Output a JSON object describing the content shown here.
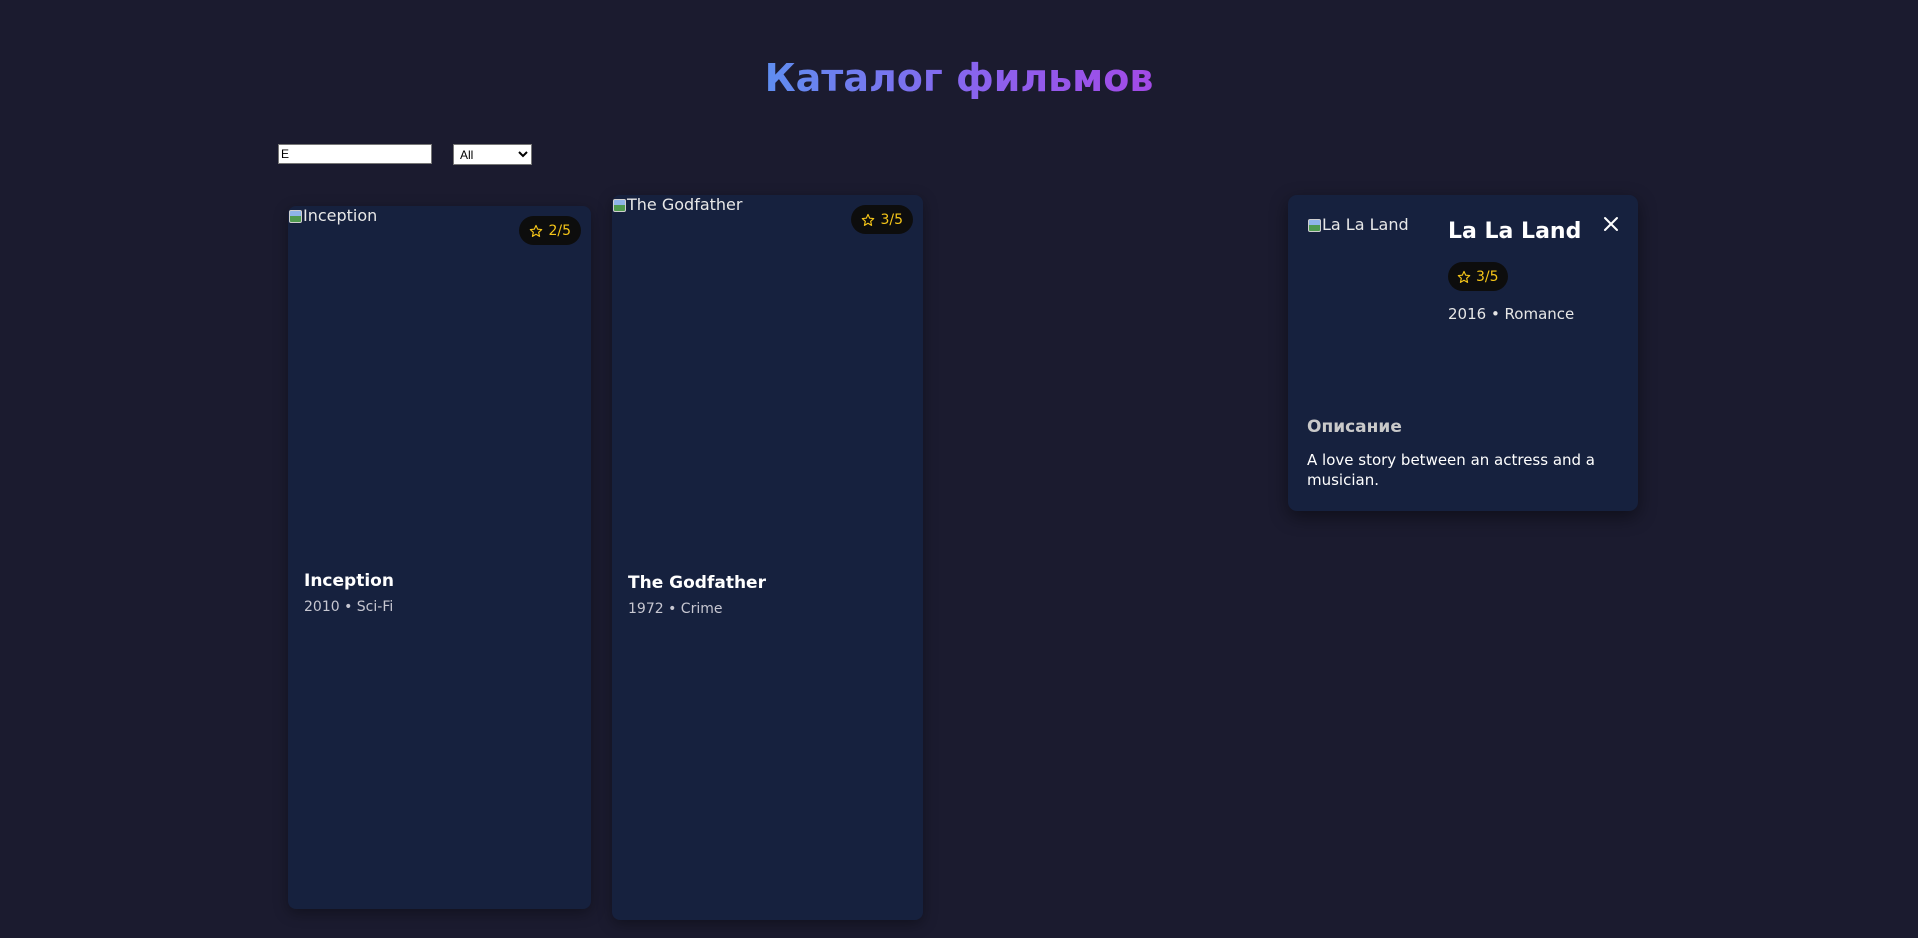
{
  "header": {
    "title": "Каталог фильмов"
  },
  "filters": {
    "search_value": "E",
    "genre_selected": "All",
    "genre_options": [
      "All"
    ]
  },
  "movies": [
    {
      "title": "Inception",
      "poster_alt": "Inception",
      "rating": "2/5",
      "meta": "2010 • Sci-Fi"
    },
    {
      "title": "The Godfather",
      "poster_alt": "The Godfather",
      "rating": "3/5",
      "meta": "1972 • Crime"
    }
  ],
  "detail": {
    "title": "La La Land",
    "poster_alt": "La La Land",
    "rating": "3/5",
    "meta": "2016 • Romance",
    "description_heading": "Описание",
    "description": "A love story between an actress and a musician."
  },
  "icons": {
    "rating": "star-icon",
    "close": "close-icon",
    "poster_placeholder": "broken-image-icon"
  },
  "colors": {
    "background": "#1b1b2f",
    "card": "#16213e",
    "star": "#f5c518",
    "title_gradient_start": "#5f8ef0",
    "title_gradient_end": "#a24ae6"
  }
}
